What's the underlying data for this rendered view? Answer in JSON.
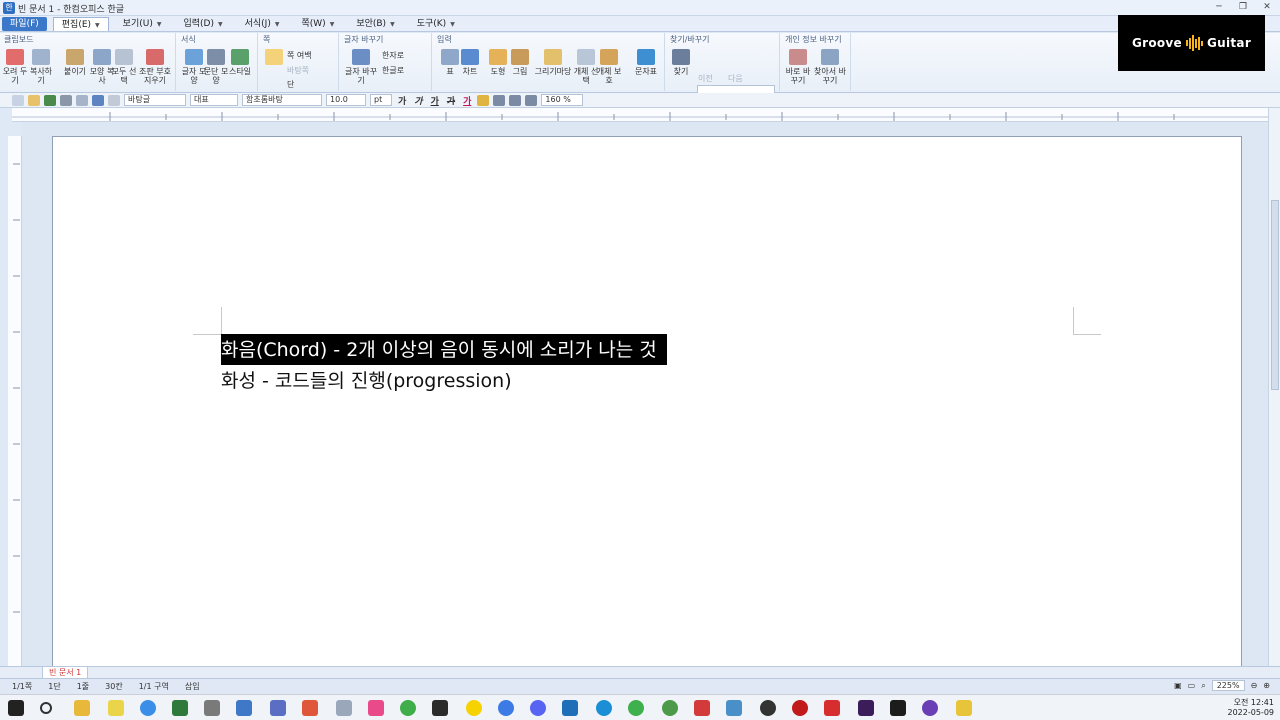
{
  "window": {
    "title": "빈 문서 1 - 한컴오피스 한글"
  },
  "menu": [
    {
      "label": "파일(F)",
      "kind": "file"
    },
    {
      "label": "편집(E)",
      "kind": "active"
    },
    {
      "label": "보기(U)"
    },
    {
      "label": "입력(D)"
    },
    {
      "label": "서식(J)"
    },
    {
      "label": "쪽(W)"
    },
    {
      "label": "보안(B)"
    },
    {
      "label": "도구(K)"
    }
  ],
  "ribbon": {
    "clipboard": {
      "title": "클립보드",
      "buttons": [
        "오려 두기",
        "복사하기",
        "붙이기",
        "모양 복사",
        "모두 선택",
        "조판 부호 지우기"
      ]
    },
    "format": {
      "title": "서식",
      "buttons": [
        "글자 모양",
        "문단 모양",
        "스타일"
      ]
    },
    "page": {
      "title": "쪽",
      "items": [
        "쪽 여백",
        "바탕쪽",
        "단"
      ]
    },
    "convert": {
      "title": "글자 바꾸기",
      "items": [
        "글자 바꾸기",
        "한자로",
        "한글로"
      ]
    },
    "insert": {
      "title": "입력",
      "buttons": [
        "표",
        "차트",
        "도형",
        "그림",
        "그리기마당",
        "개체 선택",
        "개체 보호",
        "문자표"
      ]
    },
    "find": {
      "title": "찾기/바꾸기",
      "find_label": "찾기",
      "prev": "이전",
      "next": "다음"
    },
    "privacy": {
      "title": "개인 정보 바꾸기",
      "buttons": [
        "바로 바꾸기",
        "찾아서 바꾸기"
      ]
    }
  },
  "logo": {
    "left": "Groove",
    "right": "Guitar"
  },
  "formatbar": {
    "style": "바탕글",
    "lang": "대표",
    "font": "함초롬바탕",
    "size": "10.0",
    "unit": "pt",
    "bold": "가",
    "italic": "가",
    "under": "가",
    "strike": "가",
    "color": "가",
    "zoom": "160",
    "zoom_unit": "%"
  },
  "document": {
    "line1": "화음(Chord) - 2개 이상의 음이 동시에 소리가 나는 것",
    "line2": "화성 - 코드들의 진행(progression)"
  },
  "doc_tab": "빈 문서 1",
  "status": {
    "page": "1/1쪽",
    "section": "1단",
    "line": "1줄",
    "col": "30칸",
    "part": "1/1 구역",
    "mode": "삽입",
    "zoom": "225%"
  },
  "clock": {
    "ampm": "오전 12:41",
    "date": "2022-05-09"
  }
}
